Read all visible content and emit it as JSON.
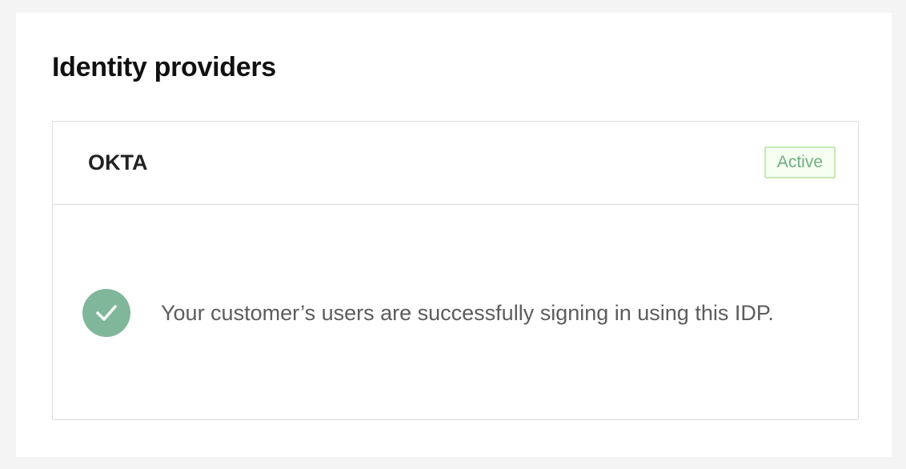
{
  "section": {
    "title": "Identity providers"
  },
  "provider": {
    "name": "OKTA",
    "status": "Active",
    "status_color": "#6fae80",
    "message": "Your customer’s users are successfully signing in using this IDP.",
    "message_icon": "check-circle-icon",
    "icon_color": "#80b79b"
  }
}
